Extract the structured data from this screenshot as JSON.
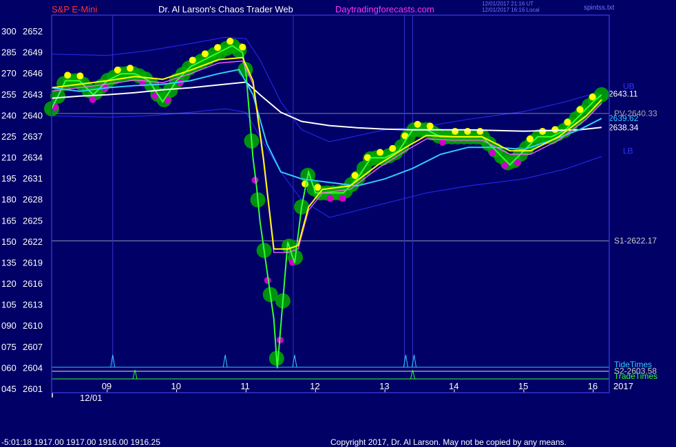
{
  "header": {
    "left_title": "S&P E-Mini",
    "center_title": "Dr. Al Larson's Chaos Trader Web",
    "site": "Daytradingforecasts.com",
    "utc_time": "12/01/2017 21:16 UT",
    "local_time": "12/01/2017 16:16 Local",
    "file": "spintss.txt"
  },
  "colors": {
    "background": "#000066",
    "plot_border": "#3333cc",
    "price": "#33ff33",
    "fast_ma": "#ffff00",
    "mid_ma": "#ff66ff",
    "cyan_ma": "#33ccff",
    "slow_ma": "#ffffff",
    "band": "#2222dd",
    "bubble_green": "#00aa00",
    "bubble_yellow": "#ffff00",
    "bubble_magenta": "#cc00cc"
  },
  "chart_data": {
    "type": "line",
    "title": "S&P E-Mini",
    "date_label": "12/01",
    "year_label": "2017",
    "x_ticks": [
      "09",
      "10",
      "11",
      "12",
      "13",
      "14",
      "15",
      "16"
    ],
    "y_ticks_left": [
      "300",
      "285",
      "270",
      "255",
      "240",
      "225",
      "210",
      "195",
      "180",
      "165",
      "150",
      "135",
      "120",
      "105",
      "090",
      "075",
      "060",
      "045"
    ],
    "y_ticks_price": [
      "2652",
      "2649",
      "2646",
      "2643",
      "2640",
      "2637",
      "2634",
      "2631",
      "2628",
      "2625",
      "2622",
      "2619",
      "2616",
      "2613",
      "2610",
      "2607",
      "2604",
      "2601"
    ],
    "ylim": [
      2601,
      2652
    ],
    "xlim": [
      8.2,
      16.15
    ],
    "levels": [
      {
        "label": "PV-2640.33",
        "value": 2640.33,
        "color": "#aaaaaa"
      },
      {
        "label": "S1-2622.17",
        "value": 2622.17,
        "color": "#cccccc"
      },
      {
        "label": "S2-2603.58",
        "value": 2603.58,
        "color": "#cccccc"
      }
    ],
    "right_labels": [
      {
        "text": "UB",
        "value": 2644.2,
        "color": "#3333ff"
      },
      {
        "text": "2643.11",
        "value": 2643.11,
        "color": "#ffffff"
      },
      {
        "text": "2639.62",
        "value": 2639.62,
        "color": "#33ccff"
      },
      {
        "text": "2638.34",
        "value": 2638.34,
        "color": "#ffffff"
      },
      {
        "text": "LB",
        "value": 2635.0,
        "color": "#3333ff"
      }
    ],
    "tide_label": "TideTimes",
    "trade_label": "TradeTimes",
    "tide_times": [
      9.08,
      10.7,
      11.7,
      13.3,
      13.42
    ],
    "trade_times": [
      9.4,
      13.4
    ],
    "vertical_lines": [
      9.08,
      11.68,
      13.28,
      13.4
    ],
    "series": [
      {
        "name": "price",
        "x": [
          8.2,
          8.4,
          8.6,
          8.8,
          9.0,
          9.2,
          9.4,
          9.6,
          9.8,
          10.0,
          10.2,
          10.4,
          10.6,
          10.8,
          10.95,
          11.0,
          11.05,
          11.1,
          11.15,
          11.2,
          11.3,
          11.4,
          11.45,
          11.5,
          11.6,
          11.7,
          11.8,
          11.9,
          12.0,
          12.2,
          12.4,
          12.6,
          12.8,
          13.0,
          13.2,
          13.4,
          13.6,
          13.8,
          14.0,
          14.2,
          14.4,
          14.6,
          14.8,
          15.0,
          15.2,
          15.4,
          15.6,
          15.8,
          16.0,
          16.12
        ],
        "values": [
          2641,
          2645,
          2645,
          2643,
          2645,
          2646,
          2646,
          2645,
          2642,
          2645,
          2647,
          2648,
          2649,
          2650,
          2649,
          2646,
          2640,
          2634,
          2630,
          2625,
          2618,
          2611,
          2604,
          2610,
          2622,
          2619,
          2627,
          2632,
          2629,
          2629,
          2629,
          2631,
          2634,
          2634,
          2635,
          2638,
          2638,
          2637,
          2637,
          2637,
          2637,
          2635,
          2633,
          2635,
          2637,
          2637,
          2638,
          2640,
          2642,
          2643
        ]
      },
      {
        "name": "fast",
        "x": [
          8.2,
          8.6,
          9.0,
          9.4,
          9.8,
          10.2,
          10.6,
          10.95,
          11.1,
          11.25,
          11.4,
          11.6,
          11.75,
          11.9,
          12.1,
          12.5,
          12.9,
          13.3,
          13.6,
          14.0,
          14.4,
          14.8,
          15.1,
          15.5,
          15.9,
          16.12
        ],
        "values": [
          2644,
          2644.5,
          2645,
          2645.6,
          2645.2,
          2646.5,
          2648,
          2648.3,
          2645,
          2634,
          2621,
          2621,
          2621.5,
          2627,
          2629.5,
          2630,
          2633,
          2635.5,
          2637.2,
          2637,
          2637,
          2635,
          2635,
          2637,
          2640,
          2642.3
        ]
      },
      {
        "name": "cyan",
        "x": [
          8.2,
          8.6,
          9.0,
          9.4,
          9.8,
          10.2,
          10.6,
          10.9,
          11.1,
          11.3,
          11.5,
          11.8,
          12.2,
          12.6,
          13.0,
          13.4,
          13.8,
          14.2,
          14.6,
          15.0,
          15.4,
          15.8,
          16.12
        ],
        "values": [
          2644,
          2643.5,
          2644,
          2644.3,
          2644.5,
          2645,
          2646,
          2646.6,
          2643,
          2636,
          2632,
          2631,
          2630.5,
          2630,
          2631,
          2632.5,
          2634.5,
          2635.5,
          2635.5,
          2635.2,
          2636.5,
          2638,
          2639.62
        ]
      },
      {
        "name": "slow",
        "x": [
          8.2,
          8.6,
          9.0,
          9.4,
          9.8,
          10.2,
          10.6,
          11.0,
          11.2,
          11.5,
          11.8,
          12.2,
          12.6,
          13.0,
          13.4,
          13.8,
          14.2,
          14.6,
          15.0,
          15.4,
          15.8,
          16.12
        ],
        "values": [
          2642.5,
          2642.8,
          2643,
          2643.3,
          2643.7,
          2644,
          2644.4,
          2644.8,
          2643,
          2640.5,
          2639.2,
          2638.6,
          2638.3,
          2638.1,
          2638.0,
          2638.0,
          2638.0,
          2637.9,
          2637.8,
          2637.9,
          2638.0,
          2638.34
        ]
      },
      {
        "name": "upper_band",
        "x": [
          8.2,
          9.0,
          9.6,
          10.2,
          10.7,
          11.0,
          11.2,
          11.5,
          11.8,
          12.2,
          13.0,
          13.6,
          14.2,
          15.0,
          15.6,
          16.12
        ],
        "values": [
          2648.8,
          2648.6,
          2649.3,
          2650.3,
          2651.2,
          2651,
          2648,
          2642,
          2638,
          2636.3,
          2638,
          2638.5,
          2639.5,
          2640.6,
          2642,
          2643.5
        ]
      },
      {
        "name": "lower_band",
        "x": [
          8.2,
          9.0,
          9.6,
          10.2,
          10.7,
          11.0,
          11.2,
          11.5,
          11.8,
          12.2,
          13.0,
          13.6,
          14.2,
          15.0,
          15.6,
          16.12
        ],
        "values": [
          2640,
          2639.8,
          2640,
          2640.5,
          2641,
          2640.5,
          2637,
          2632,
          2628,
          2625.5,
          2627.5,
          2629,
          2630,
          2631,
          2632.4,
          2634.2
        ]
      }
    ]
  },
  "footer": {
    "readout": "-5:01:18  1917.00 1917.00 1916.00 1916.25",
    "copyright": "Copyright 2017, Dr. Al Larson. May not be copied by any means."
  }
}
